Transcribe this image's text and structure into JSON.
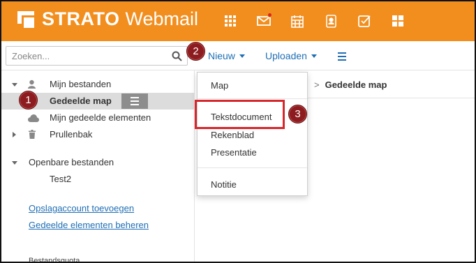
{
  "header": {
    "brand": "STRATO",
    "product": "Webmail",
    "apps": [
      {
        "icon": "grid-icon"
      },
      {
        "icon": "mail-icon",
        "badge": true
      },
      {
        "icon": "calendar-icon"
      },
      {
        "icon": "contacts-icon"
      },
      {
        "icon": "tasks-icon"
      },
      {
        "icon": "dashboard-icon"
      }
    ],
    "color": "#f28e1e"
  },
  "search": {
    "placeholder": "Zoeken..."
  },
  "toolbar": {
    "new_label": "Nieuw",
    "upload_label": "Uploaden"
  },
  "markers": {
    "step1": "1",
    "step2": "2",
    "step3": "3"
  },
  "sidebar": {
    "my_files": "Mijn bestanden",
    "shared_folder": "Gedeelde map",
    "my_shared_items": "Mijn gedeelde elementen",
    "trash": "Prullenbak",
    "public_files": "Openbare bestanden",
    "test2": "Test2",
    "add_storage_link": "Opslagaccount toevoegen",
    "manage_shared_link": "Gedeelde elementen beheren",
    "quota_label": "Bestandsquota"
  },
  "breadcrumb": {
    "separator": ">",
    "current": "Gedeelde map"
  },
  "new_menu": {
    "items": [
      "Map",
      "Tekstdocument",
      "Rekenblad",
      "Presentatie",
      "Notitie"
    ]
  },
  "colors": {
    "accent_link": "#1f6fb5",
    "marker": "#8c1c1f",
    "highlight": "#d7262c"
  }
}
